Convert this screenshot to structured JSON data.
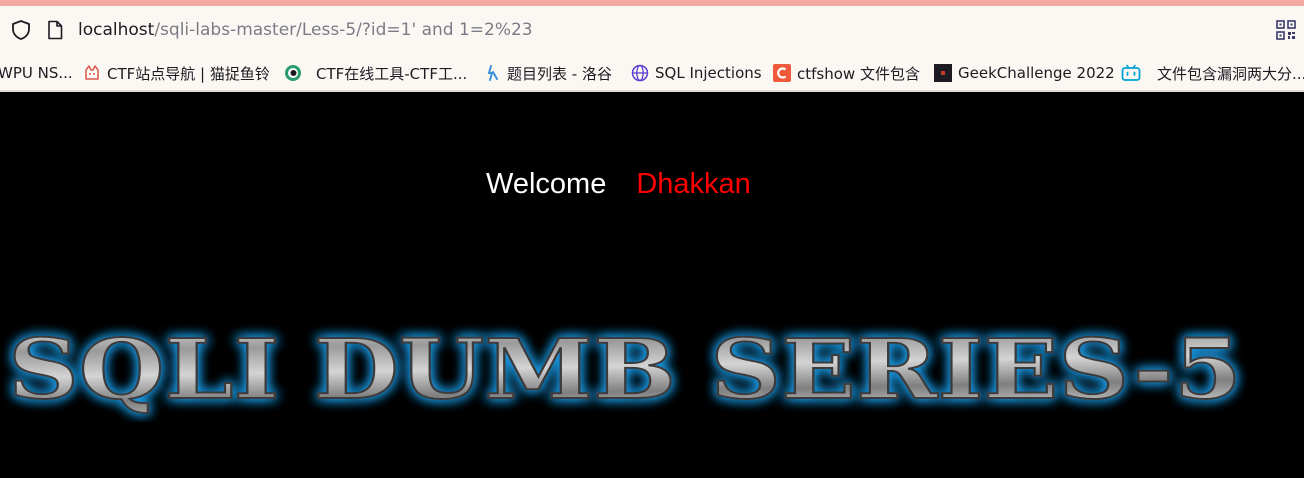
{
  "browser": {
    "url_host": "localhost",
    "url_path": "/sqli-labs-master/Less-5/?id=1' and 1=2%23",
    "icons": {
      "shield": "shield-icon",
      "page": "page-icon",
      "qr": "qr-code-icon"
    },
    "colors": {
      "accent_strip": "#f4a9a1",
      "toolbar_bg": "#fbf8f4"
    }
  },
  "bookmarks": [
    {
      "label": "WPU NS...",
      "icon": "none"
    },
    {
      "label": "CTF站点导航 | 猫捉鱼铃",
      "icon": "cat-icon"
    },
    {
      "label": "CTF在线工具-CTF工...",
      "icon": "eye-icon"
    },
    {
      "label": "题目列表 - 洛谷",
      "icon": "luogu-icon"
    },
    {
      "label": "SQL Injections",
      "icon": "globe-icon"
    },
    {
      "label": "ctfshow 文件包含",
      "icon": "ctfshow-icon"
    },
    {
      "label": "GeekChallenge 2022",
      "icon": "geek-icon"
    },
    {
      "label": "文件包含漏洞两大分...",
      "icon": "bilibili-icon"
    }
  ],
  "page": {
    "welcome": "Welcome",
    "name": "Dhakkan",
    "banner_title": "SQLI DUMB SERIES-5",
    "colors": {
      "background": "#000000",
      "welcome_text": "#ffffff",
      "name_text": "#ff0000",
      "banner_glow": "#1e9be6"
    }
  }
}
